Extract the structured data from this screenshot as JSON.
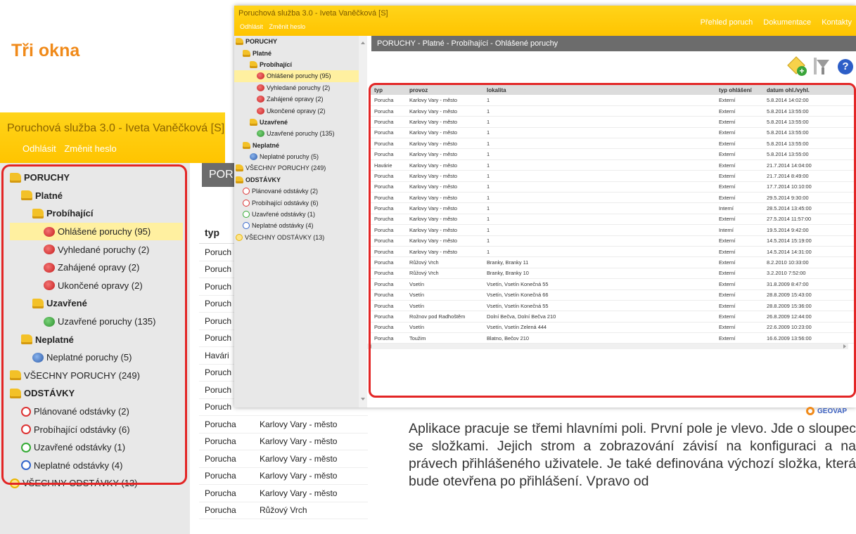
{
  "slide_title": "Tři okna",
  "app_title": "Poruchová služba 3.0 - Iveta Vaněčková [S]",
  "user_links": [
    "Odhlásit",
    "Změnit heslo"
  ],
  "top_nav": [
    "Přehled poruch",
    "Dokumentace",
    "Kontakty"
  ],
  "breadcrumb": "PORUCHY - Platné - Probíhající - Ohlášené poruchy",
  "bg_breadcrumb_fragment": "POR",
  "tree": [
    {
      "label": "PORUCHY",
      "icon": "folder-icon",
      "level": 0,
      "bold": true
    },
    {
      "label": "Platné",
      "icon": "folder-icon",
      "level": 1,
      "bold": true
    },
    {
      "label": "Probíhající",
      "icon": "folder-icon",
      "level": 2,
      "bold": true
    },
    {
      "label": "Ohlášené poruchy (95)",
      "icon": "red-fault-icon",
      "level": 3,
      "selected": true
    },
    {
      "label": "Vyhledané poruchy (2)",
      "icon": "red-fault-icon",
      "level": 3
    },
    {
      "label": "Zahájené opravy (2)",
      "icon": "red-fault-icon",
      "level": 3
    },
    {
      "label": "Ukončené opravy (2)",
      "icon": "red-fault-icon",
      "level": 3
    },
    {
      "label": "Uzavřené",
      "icon": "folder-icon",
      "level": 2,
      "bold": true
    },
    {
      "label": "Uzavřené poruchy (135)",
      "icon": "green-fault-icon",
      "level": 3
    },
    {
      "label": "Neplatné",
      "icon": "folder-icon",
      "level": 1,
      "bold": true
    },
    {
      "label": "Neplatné poruchy (5)",
      "icon": "blue-fault-icon",
      "level": 2
    },
    {
      "label": "VŠECHNY PORUCHY (249)",
      "icon": "folder-icon",
      "level": 0
    },
    {
      "label": "ODSTÁVKY",
      "icon": "folder-icon",
      "level": 0,
      "bold": true
    },
    {
      "label": "Plánované odstávky (2)",
      "icon": "red-outage-icon",
      "level": 1
    },
    {
      "label": "Probíhající odstávky (6)",
      "icon": "red-outage-icon",
      "level": 1
    },
    {
      "label": "Uzavřené odstávky (1)",
      "icon": "green-outage-icon",
      "level": 1
    },
    {
      "label": "Neplatné odstávky (4)",
      "icon": "blue-outage-icon",
      "level": 1
    },
    {
      "label": "VŠECHNY ODSTÁVKY (13)",
      "icon": "yellow-outage-icon",
      "level": 0
    }
  ],
  "table": {
    "columns": [
      "typ",
      "provoz",
      "lokalita",
      "typ ohlášení",
      "datum ohl./vyhl."
    ],
    "rows": [
      [
        "Porucha",
        "Karlovy Vary - město",
        "1",
        "Externí",
        "5.8.2014 14:02:00"
      ],
      [
        "Porucha",
        "Karlovy Vary - město",
        "1",
        "Externí",
        "5.8.2014 13:55:00"
      ],
      [
        "Porucha",
        "Karlovy Vary - město",
        "1",
        "Externí",
        "5.8.2014 13:55:00"
      ],
      [
        "Porucha",
        "Karlovy Vary - město",
        "1",
        "Externí",
        "5.8.2014 13:55:00"
      ],
      [
        "Porucha",
        "Karlovy Vary - město",
        "1",
        "Externí",
        "5.8.2014 13:55:00"
      ],
      [
        "Porucha",
        "Karlovy Vary - město",
        "1",
        "Externí",
        "5.8.2014 13:55:00"
      ],
      [
        "Havárie",
        "Karlovy Vary - město",
        "1",
        "Externí",
        "21.7.2014 14:04:00"
      ],
      [
        "Porucha",
        "Karlovy Vary - město",
        "1",
        "Externí",
        "21.7.2014 8:49:00"
      ],
      [
        "Porucha",
        "Karlovy Vary - město",
        "1",
        "Externí",
        "17.7.2014 10:10:00"
      ],
      [
        "Porucha",
        "Karlovy Vary - město",
        "1",
        "Externí",
        "29.5.2014 9:30:00"
      ],
      [
        "Porucha",
        "Karlovy Vary - město",
        "1",
        "Interní",
        "28.5.2014 13:45:00"
      ],
      [
        "Porucha",
        "Karlovy Vary - město",
        "1",
        "Externí",
        "27.5.2014 11:57:00"
      ],
      [
        "Porucha",
        "Karlovy Vary - město",
        "1",
        "Interní",
        "19.5.2014 9:42:00"
      ],
      [
        "Porucha",
        "Karlovy Vary - město",
        "1",
        "Externí",
        "14.5.2014 15:19:00"
      ],
      [
        "Porucha",
        "Karlovy Vary - město",
        "1",
        "Externí",
        "14.5.2014 14:31:00"
      ],
      [
        "Porucha",
        "Růžový Vrch",
        "Branky, Branky 11",
        "Externí",
        "8.2.2010 10:33:00"
      ],
      [
        "Porucha",
        "Růžový Vrch",
        "Branky, Branky 10",
        "Externí",
        "3.2.2010 7:52:00"
      ],
      [
        "Porucha",
        "Vsetín",
        "Vsetín, Vsetín Konečná 55",
        "Externí",
        "31.8.2009 8:47:00"
      ],
      [
        "Porucha",
        "Vsetín",
        "Vsetín, Vsetín Konečná 66",
        "Externí",
        "28.8.2009 15:43:00"
      ],
      [
        "Porucha",
        "Vsetín",
        "Vsetín, Vsetín Konečná 55",
        "Externí",
        "28.8.2009 15:36:00"
      ],
      [
        "Porucha",
        "Rožnov pod Radhoštěm",
        "Dolní Bečva, Dolní Bečva 210",
        "Externí",
        "26.8.2009 12:44:00"
      ],
      [
        "Porucha",
        "Vsetín",
        "Vsetín, Vsetín Zelená 444",
        "Externí",
        "22.6.2009 10:23:00"
      ],
      [
        "Porucha",
        "Toužim",
        "Blatno, Bečov 210",
        "Externí",
        "16.6.2009 13:56:00"
      ]
    ]
  },
  "bg_table": {
    "header": "typ",
    "rows": [
      [
        "Poruch",
        ""
      ],
      [
        "Poruch",
        ""
      ],
      [
        "Poruch",
        ""
      ],
      [
        "Poruch",
        ""
      ],
      [
        "Poruch",
        ""
      ],
      [
        "Poruch",
        ""
      ],
      [
        "Havári",
        ""
      ],
      [
        "Poruch",
        ""
      ],
      [
        "Poruch",
        ""
      ],
      [
        "Poruch",
        ""
      ],
      [
        "Porucha",
        "Karlovy Vary - město"
      ],
      [
        "Porucha",
        "Karlovy Vary - město"
      ],
      [
        "Porucha",
        "Karlovy Vary - město"
      ],
      [
        "Porucha",
        "Karlovy Vary - město"
      ],
      [
        "Porucha",
        "Karlovy Vary - město"
      ],
      [
        "Porucha",
        "Růžový Vrch"
      ]
    ]
  },
  "brand": "GEOVAP",
  "paragraph": "Aplikace pracuje se třemi hlavními poli. První pole je vlevo. Jde o sloupec se složkami. Jejich strom a zobrazování závisí na konfiguraci a na právech přihlášeného uživatele. Je také definována výchozí složka, která bude otevřena po přihlášení. Vpravo od"
}
